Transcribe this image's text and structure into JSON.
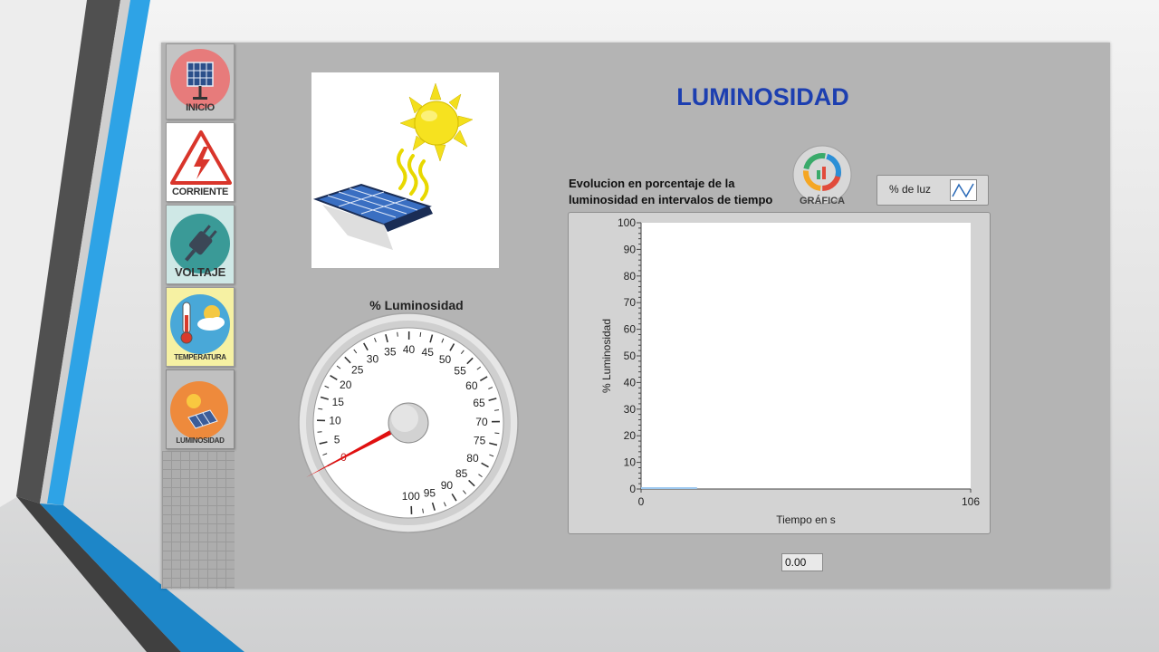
{
  "nav": {
    "inicio_label": "INICIO",
    "corriente_label": "CORRIENTE",
    "voltaje_label": "VOLTAJE",
    "temperatura_label": "TEMPERATURA",
    "luminosidad_label": "LUMINOSIDAD"
  },
  "header": {
    "title": "LUMINOSIDAD"
  },
  "gauge": {
    "label": "% Luminosidad",
    "ticks": [
      "0",
      "5",
      "10",
      "15",
      "20",
      "25",
      "30",
      "35",
      "40",
      "45",
      "50",
      "55",
      "60",
      "65",
      "70",
      "75",
      "80",
      "85",
      "90",
      "95",
      "100"
    ],
    "value": 0
  },
  "chart": {
    "title_line1": "Evolucion en porcentaje de la",
    "title_line2": "luminosidad en intervalos de tiempo",
    "grafica_label": "GRÁFICA",
    "legend_label": "% de luz",
    "indicator_value": "0.00"
  },
  "colors": {
    "title": "#1d3fb0",
    "needle": "#e01010",
    "plot_line": "#9ec9f0"
  },
  "chart_data": {
    "type": "line",
    "title": "Evolucion en porcentaje de la luminosidad en intervalos de tiempo",
    "xlabel": "Tiempo en s",
    "ylabel": "% Luminosidad",
    "xlim": [
      0,
      106
    ],
    "ylim": [
      0,
      100
    ],
    "x_ticks": [
      "0",
      "106"
    ],
    "y_ticks": [
      "0",
      "10",
      "20",
      "30",
      "40",
      "50",
      "60",
      "70",
      "80",
      "90",
      "100"
    ],
    "grid": false,
    "legend": "top-right",
    "series": [
      {
        "name": "% de luz",
        "x": [
          0,
          18
        ],
        "y": [
          0,
          0
        ]
      }
    ]
  }
}
